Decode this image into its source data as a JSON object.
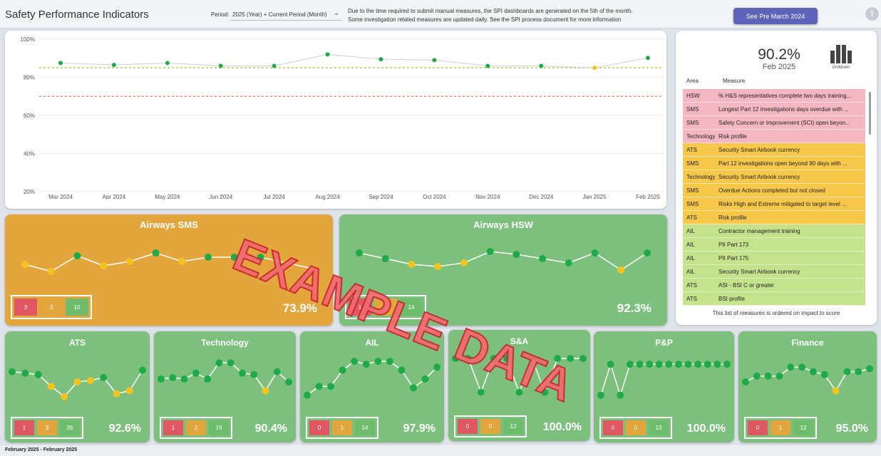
{
  "header": {
    "title": "Safety Performance Indicators",
    "period_label": "Period:",
    "period_value": "2025 (Year) + Current Period (Month)",
    "notice_line1": "Due to the time required to submit manual measures, the SPI dashboards are generated on the 5th of the month.",
    "notice_line2": "Some investigation related measures are updated daily. See the SPI process document for more information",
    "pre_button": "See Pre March 2024",
    "info_icon": "info-icon"
  },
  "chart_data": [
    {
      "type": "line",
      "title": "",
      "xlabel": "",
      "ylabel": "",
      "categories": [
        "Mar 2024",
        "Apr 2024",
        "May 2024",
        "Jun 2024",
        "Jul 2024",
        "Aug 2024",
        "Sep 2024",
        "Oct 2024",
        "Nov 2024",
        "Dec 2024",
        "Jan 2025",
        "Feb 2025"
      ],
      "y_ticks": [
        "100%",
        "80%",
        "60%",
        "40%",
        "20%"
      ],
      "ylim": [
        20,
        100
      ],
      "series": [
        {
          "values": [
            87.5,
            86.5,
            87.5,
            86.0,
            86.0,
            92.0,
            89.5,
            89.0,
            86.0,
            86.0,
            85.0,
            90.2
          ],
          "status": [
            "green",
            "green",
            "green",
            "green",
            "green",
            "green",
            "green",
            "green",
            "green",
            "green",
            "amber",
            "green"
          ]
        }
      ],
      "target_lines": [
        {
          "value": 85,
          "color": "#a7d14d"
        },
        {
          "value": 70,
          "color": "#f08a6a"
        }
      ],
      "grid": true
    }
  ],
  "summary": {
    "value": "90.2%",
    "period": "Feb 2025",
    "drill_label": "Drilldown",
    "col_area": "Area",
    "col_measure": "Measure",
    "footnote": "This list of measures is ordered on impact to score",
    "rows": [
      {
        "area": "HSW",
        "measure": "% H&S representatives complete two days training...",
        "status": "red"
      },
      {
        "area": "SMS",
        "measure": "Longest Part 12 investigations days overdue with ...",
        "status": "red"
      },
      {
        "area": "SMS",
        "measure": "Safety Concern or Improvement (SCI) open beyon...",
        "status": "red"
      },
      {
        "area": "Technology",
        "measure": "Risk profile",
        "status": "red"
      },
      {
        "area": "ATS",
        "measure": "Security Smart Airbook currency",
        "status": "amber"
      },
      {
        "area": "SMS",
        "measure": "Part 12 investigations  open beyond 90 days with ...",
        "status": "amber"
      },
      {
        "area": "Technology",
        "measure": "Security Smart Airbook currency",
        "status": "amber"
      },
      {
        "area": "SMS",
        "measure": "Overdue Actions completed but not closed",
        "status": "amber"
      },
      {
        "area": "SMS",
        "measure": "Risks High and Extreme mitigated to target level ...",
        "status": "amber"
      },
      {
        "area": "ATS",
        "measure": "Risk profile",
        "status": "amber"
      },
      {
        "area": "AIL",
        "measure": "Contractor management training",
        "status": "green"
      },
      {
        "area": "AIL",
        "measure": "PII Part 173",
        "status": "green"
      },
      {
        "area": "AIL",
        "measure": "PII Part 175",
        "status": "green"
      },
      {
        "area": "AIL",
        "measure": "Security Smart Airbook currency",
        "status": "green"
      },
      {
        "area": "ATS",
        "measure": "ASI - BSI C or greater",
        "status": "green"
      },
      {
        "area": "ATS",
        "measure": "BSI profile",
        "status": "green"
      }
    ]
  },
  "colors": {
    "red": "#f5b8c3",
    "amber": "#f7c84a",
    "green": "#c5e28c",
    "dot_green": "#1faa4a",
    "dot_amber": "#f3c51c"
  },
  "panels": [
    {
      "key": "sms",
      "title": "Airways SMS",
      "bg": "#e3a63d",
      "red": "3",
      "amber": "3",
      "green": "10",
      "score": "73.9%",
      "points": [
        70,
        60,
        82,
        68,
        74,
        86,
        74,
        80,
        80,
        80,
        72,
        64
      ],
      "dots": [
        "a",
        "a",
        "g",
        "a",
        "a",
        "g",
        "a",
        "g",
        "g",
        "g",
        "a",
        "a"
      ]
    },
    {
      "key": "hsw",
      "title": "Airways HSW",
      "bg": "#7dc07d",
      "red": "1",
      "amber": "0",
      "green": "14",
      "score": "92.3%",
      "points": [
        86,
        78,
        70,
        67,
        72,
        88,
        84,
        78,
        72,
        86,
        62,
        86
      ],
      "dots": [
        "g",
        "g",
        "a",
        "a",
        "a",
        "g",
        "g",
        "g",
        "g",
        "g",
        "a",
        "g"
      ]
    },
    {
      "key": "ats",
      "title": "ATS",
      "bg": "#7dc07d",
      "red": "1",
      "amber": "3",
      "green": "26",
      "score": "92.6%",
      "points": [
        82,
        80,
        78,
        62,
        48,
        68,
        70,
        74,
        52,
        56,
        84
      ],
      "dots": [
        "g",
        "g",
        "g",
        "a",
        "a",
        "a",
        "a",
        "g",
        "a",
        "a",
        "g"
      ]
    },
    {
      "key": "tech",
      "title": "Technology",
      "bg": "#7dc07d",
      "red": "1",
      "amber": "2",
      "green": "19",
      "score": "90.4%",
      "points": [
        72,
        74,
        72,
        80,
        72,
        94,
        94,
        80,
        78,
        56,
        82,
        68
      ],
      "dots": [
        "g",
        "g",
        "g",
        "g",
        "g",
        "g",
        "g",
        "g",
        "g",
        "a",
        "g",
        "g"
      ]
    },
    {
      "key": "ail",
      "title": "AIL",
      "bg": "#7dc07d",
      "red": "0",
      "amber": "1",
      "green": "14",
      "score": "97.9%",
      "points": [
        50,
        62,
        62,
        84,
        96,
        92,
        96,
        96,
        84,
        60,
        72,
        88
      ],
      "dots": [
        "g",
        "g",
        "g",
        "g",
        "g",
        "g",
        "g",
        "g",
        "g",
        "g",
        "g",
        "g"
      ]
    },
    {
      "key": "sa",
      "title": "S&A",
      "bg": "#7dc07d",
      "red": "0",
      "amber": "0",
      "green": "13",
      "score": "100.0%",
      "points": [
        98,
        98,
        52,
        98,
        98,
        52,
        98,
        52,
        98,
        98,
        98
      ],
      "dots": [
        "g",
        "g",
        "g",
        "g",
        "g",
        "g",
        "g",
        "g",
        "g",
        "g",
        "g"
      ]
    },
    {
      "key": "pp",
      "title": "P&P",
      "bg": "#7dc07d",
      "red": "0",
      "amber": "0",
      "green": "13",
      "score": "100.0%",
      "points": [
        50,
        92,
        50,
        92,
        92,
        92,
        92,
        92,
        92,
        92,
        92,
        92,
        92,
        92
      ],
      "dots": [
        "g",
        "g",
        "g",
        "g",
        "g",
        "g",
        "g",
        "g",
        "g",
        "g",
        "g",
        "g",
        "g",
        "g"
      ]
    },
    {
      "key": "fin",
      "title": "Finance",
      "bg": "#7dc07d",
      "red": "0",
      "amber": "1",
      "green": "12",
      "score": "95.0%",
      "points": [
        68,
        76,
        76,
        76,
        88,
        88,
        82,
        78,
        56,
        82,
        82,
        86
      ],
      "dots": [
        "g",
        "g",
        "g",
        "g",
        "g",
        "g",
        "g",
        "g",
        "a",
        "g",
        "g",
        "g"
      ]
    }
  ],
  "watermark": "EXAMPLE DATA",
  "footer": "February 2025 - February 2025"
}
